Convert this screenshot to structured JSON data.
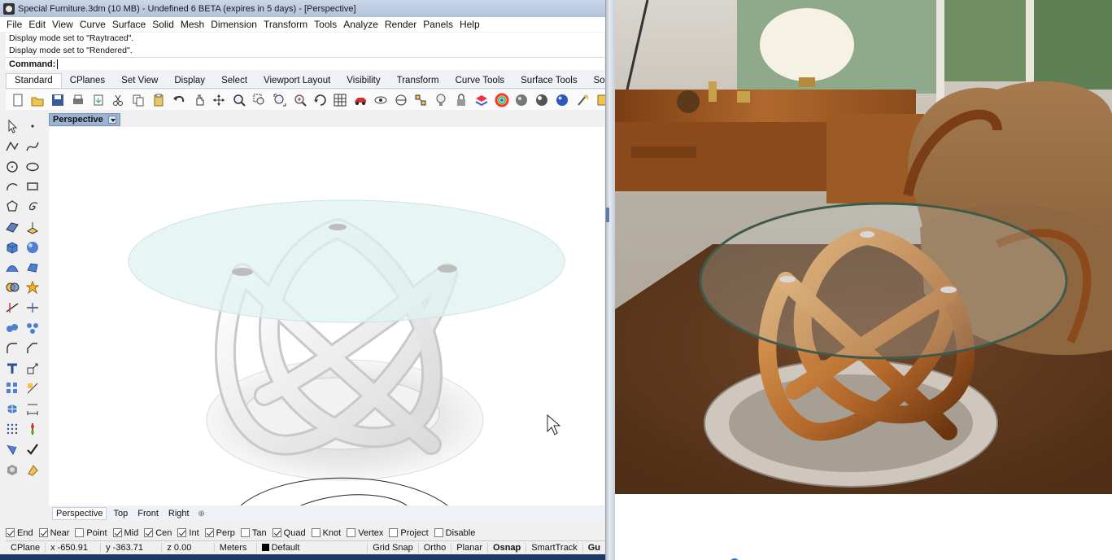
{
  "window": {
    "title": "Special Furniture.3dm (10 MB) - Undefined 6 BETA (expires in 5 days) - [Perspective]"
  },
  "menu": [
    "File",
    "Edit",
    "View",
    "Curve",
    "Surface",
    "Solid",
    "Mesh",
    "Dimension",
    "Transform",
    "Tools",
    "Analyze",
    "Render",
    "Panels",
    "Help"
  ],
  "history": [
    "Display mode set to \"Raytraced\".",
    "Display mode set to \"Rendered\"."
  ],
  "command": {
    "label": "Command:",
    "value": ""
  },
  "toolbar_tabs": [
    "Standard",
    "CPlanes",
    "Set View",
    "Display",
    "Select",
    "Viewport Layout",
    "Visibility",
    "Transform",
    "Curve Tools",
    "Surface Tools",
    "Solid T"
  ],
  "toolbar_icons": [
    "new-icon",
    "open-icon",
    "save-icon",
    "print-icon",
    "import-icon",
    "cut-icon",
    "copy-icon",
    "paste-icon",
    "undo-icon",
    "pan-icon",
    "move-icon",
    "zoom-icon",
    "zoom-window-icon",
    "zoom-extents-icon",
    "zoom-selected-icon",
    "rotate-view-icon",
    "grid-icon",
    "car-icon",
    "hide-icon",
    "distance-icon",
    "osnap-icon",
    "light-icon",
    "lock-icon",
    "layers-icon",
    "color-wheel-icon",
    "material-sphere-icon",
    "render-sphere-icon",
    "shaded-sphere-icon",
    "properties-icon",
    "extra-icon"
  ],
  "left_tools": [
    "select-arrow-icon",
    "point-icon",
    "polyline-icon",
    "curve-icon",
    "circle-icon",
    "ellipse-icon",
    "arc-icon",
    "rectangle-icon",
    "polygon-icon",
    "spiral-icon",
    "surface-icon",
    "extrude-surface-icon",
    "box-icon",
    "sphere-icon",
    "loft-icon",
    "patch-icon",
    "boolean-icon",
    "explode-icon",
    "trim-icon",
    "split-icon",
    "join-icon",
    "group-icon",
    "fillet-icon",
    "chamfer-icon",
    "text-icon",
    "scale-icon",
    "array-icon",
    "transform-icon",
    "mesh-icon",
    "dimension-icon",
    "point-grid-icon",
    "gumball-icon",
    "analyze-icon",
    "check-icon",
    "render-icon",
    "paint-icon"
  ],
  "viewport": {
    "name": "Perspective"
  },
  "viewport_tabs": [
    "Perspective",
    "Top",
    "Front",
    "Right"
  ],
  "osnaps": [
    {
      "label": "End",
      "checked": true
    },
    {
      "label": "Near",
      "checked": true
    },
    {
      "label": "Point",
      "checked": false
    },
    {
      "label": "Mid",
      "checked": true
    },
    {
      "label": "Cen",
      "checked": true
    },
    {
      "label": "Int",
      "checked": true
    },
    {
      "label": "Perp",
      "checked": true
    },
    {
      "label": "Tan",
      "checked": false
    },
    {
      "label": "Quad",
      "checked": true
    },
    {
      "label": "Knot",
      "checked": false
    },
    {
      "label": "Vertex",
      "checked": false
    },
    {
      "label": "Project",
      "checked": false
    },
    {
      "label": "Disable",
      "checked": false
    }
  ],
  "status": {
    "cplane": "CPlane",
    "x": "x -650.91",
    "y": "y -363.71",
    "z": "z 0.00",
    "units": "Meters",
    "layer": "Default",
    "grid_snap": "Grid Snap",
    "ortho": "Ortho",
    "planar": "Planar",
    "osnap": "Osnap",
    "smarttrack": "SmartTrack",
    "gumball": "Gu"
  },
  "colors": {
    "title_bar": "#c1cfe3",
    "active_viewport_tab": "#9db3d3",
    "glass_top": "#dff1f2",
    "wood": "#b4682a"
  }
}
